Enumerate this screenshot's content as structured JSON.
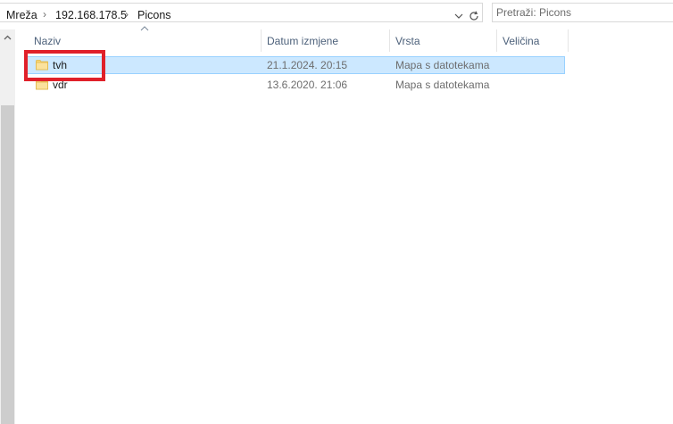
{
  "address_bar": {
    "breadcrumbs": [
      "Mreža",
      "192.168.178.5",
      "Picons"
    ]
  },
  "search": {
    "placeholder": "Pretraži: Picons"
  },
  "columns": [
    "Naziv",
    "Datum izmjene",
    "Vrsta",
    "Veličina"
  ],
  "rows": [
    {
      "name": "tvh",
      "date": "21.1.2024. 20:15",
      "type": "Mapa s datotekama",
      "size": "",
      "selected": true
    },
    {
      "name": "vdr",
      "date": "13.6.2020. 21:06",
      "type": "Mapa s datotekama",
      "size": "",
      "selected": false
    }
  ],
  "icons": {
    "folder": "folder-icon",
    "separator": "chevron-right-icon",
    "dropdown": "chevron-down-icon",
    "refresh": "refresh-icon",
    "sort": "sort-ascending-icon"
  },
  "colors": {
    "selection_fill": "#cce8ff",
    "selection_border": "#99d1ff",
    "highlight": "#e0202a",
    "header_text": "#4c607a",
    "folder": "#f8d775"
  }
}
